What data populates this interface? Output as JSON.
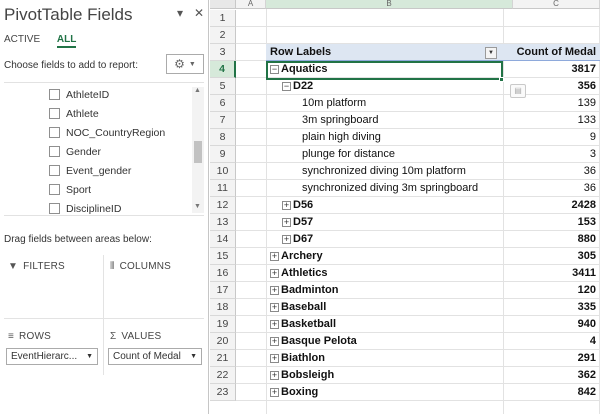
{
  "pane": {
    "title": "PivotTable Fields",
    "close_glyph": "✕",
    "menu_glyph": "▾",
    "tabs": [
      {
        "label": "ACTIVE"
      },
      {
        "label": "ALL"
      }
    ],
    "choose_label": "Choose fields to add to report:",
    "fields": [
      {
        "label": "AthleteID"
      },
      {
        "label": "Athlete"
      },
      {
        "label": "NOC_CountryRegion"
      },
      {
        "label": "Gender"
      },
      {
        "label": "Event_gender"
      },
      {
        "label": "Sport"
      },
      {
        "label": "DisciplineID"
      }
    ],
    "drag_label": "Drag fields between areas below:",
    "areas": {
      "filters": {
        "label": "FILTERS",
        "icon": "filter-icon"
      },
      "columns": {
        "label": "COLUMNS",
        "icon": "columns-icon"
      },
      "rows": {
        "label": "ROWS",
        "icon": "rows-icon",
        "field": "EventHierarc..."
      },
      "values": {
        "label": "VALUES",
        "icon": "sigma-icon",
        "field": "Count of Medal"
      }
    }
  },
  "grid": {
    "columns": [
      "A",
      "B",
      "C"
    ],
    "rows": [
      "1",
      "2",
      "3",
      "4",
      "5",
      "6",
      "7",
      "8",
      "9",
      "10",
      "11",
      "12",
      "13",
      "14",
      "15",
      "16",
      "17",
      "18",
      "19",
      "20",
      "21",
      "22",
      "23"
    ],
    "header": {
      "row_labels": "Row Labels",
      "value_header": "Count of Medal"
    },
    "pivot": [
      {
        "label": "Aquatics",
        "value": "3817",
        "level": 0,
        "toggle": "−",
        "bold": true
      },
      {
        "label": "D22",
        "value": "356",
        "level": 1,
        "toggle": "−",
        "bold": true
      },
      {
        "label": "10m platform",
        "value": "139",
        "level": 2,
        "toggle": "",
        "bold": false
      },
      {
        "label": "3m springboard",
        "value": "133",
        "level": 2,
        "toggle": "",
        "bold": false
      },
      {
        "label": "plain high diving",
        "value": "9",
        "level": 2,
        "toggle": "",
        "bold": false
      },
      {
        "label": "plunge for distance",
        "value": "3",
        "level": 2,
        "toggle": "",
        "bold": false
      },
      {
        "label": "synchronized diving 10m platform",
        "value": "36",
        "level": 2,
        "toggle": "",
        "bold": false
      },
      {
        "label": "synchronized diving 3m springboard",
        "value": "36",
        "level": 2,
        "toggle": "",
        "bold": false
      },
      {
        "label": "D56",
        "value": "2428",
        "level": 1,
        "toggle": "+",
        "bold": true
      },
      {
        "label": "D57",
        "value": "153",
        "level": 1,
        "toggle": "+",
        "bold": true
      },
      {
        "label": "D67",
        "value": "880",
        "level": 1,
        "toggle": "+",
        "bold": true
      },
      {
        "label": "Archery",
        "value": "305",
        "level": 0,
        "toggle": "+",
        "bold": true
      },
      {
        "label": "Athletics",
        "value": "3411",
        "level": 0,
        "toggle": "+",
        "bold": true
      },
      {
        "label": "Badminton",
        "value": "120",
        "level": 0,
        "toggle": "+",
        "bold": true
      },
      {
        "label": "Baseball",
        "value": "335",
        "level": 0,
        "toggle": "+",
        "bold": true
      },
      {
        "label": "Basketball",
        "value": "940",
        "level": 0,
        "toggle": "+",
        "bold": true
      },
      {
        "label": "Basque Pelota",
        "value": "4",
        "level": 0,
        "toggle": "+",
        "bold": true
      },
      {
        "label": "Biathlon",
        "value": "291",
        "level": 0,
        "toggle": "+",
        "bold": true
      },
      {
        "label": "Bobsleigh",
        "value": "362",
        "level": 0,
        "toggle": "+",
        "bold": true
      },
      {
        "label": "Boxing",
        "value": "842",
        "level": 0,
        "toggle": "+",
        "bold": true
      }
    ]
  },
  "colors": {
    "accent": "#217346",
    "header_fill": "#dde6f2"
  }
}
